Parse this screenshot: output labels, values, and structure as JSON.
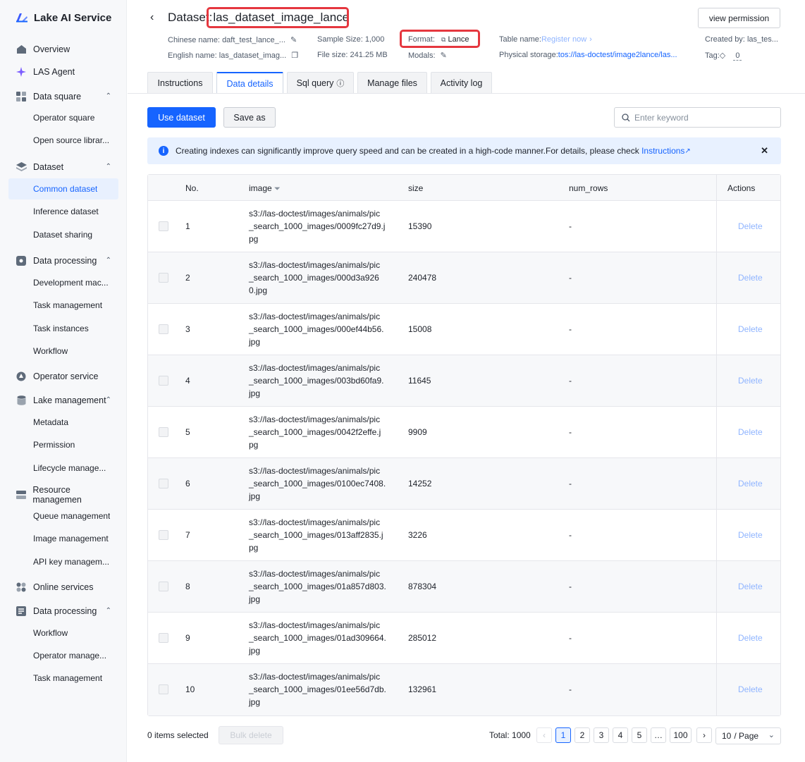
{
  "app": {
    "brand": "Lake AI Service"
  },
  "sidebar": {
    "items": [
      {
        "label": "Overview",
        "icon": "home-icon",
        "level": "top"
      },
      {
        "label": "LAS Agent",
        "icon": "sparkle-icon",
        "level": "top"
      },
      {
        "label": "Data square",
        "icon": "grid-icon",
        "level": "top",
        "expanded": true
      },
      {
        "label": "Operator square",
        "level": "sub"
      },
      {
        "label": "Open source librar...",
        "level": "sub"
      },
      {
        "label": "Dataset",
        "icon": "layers-icon",
        "level": "top",
        "expanded": true
      },
      {
        "label": "Common dataset",
        "level": "sub",
        "active": true
      },
      {
        "label": "Inference dataset",
        "level": "sub"
      },
      {
        "label": "Dataset sharing",
        "level": "sub"
      },
      {
        "label": "Data processing",
        "icon": "gear-icon",
        "level": "top",
        "expanded": true
      },
      {
        "label": "Development mac...",
        "level": "sub"
      },
      {
        "label": "Task management",
        "level": "sub"
      },
      {
        "label": "Task instances",
        "level": "sub"
      },
      {
        "label": "Workflow",
        "level": "sub"
      },
      {
        "label": "Operator service",
        "icon": "operator-icon",
        "level": "top"
      },
      {
        "label": "Lake management",
        "icon": "database-icon",
        "level": "top",
        "expanded": true
      },
      {
        "label": "Metadata",
        "level": "sub"
      },
      {
        "label": "Permission",
        "level": "sub"
      },
      {
        "label": "Lifecycle manage...",
        "level": "sub"
      },
      {
        "label": "Resource managemen",
        "icon": "server-icon",
        "level": "top"
      },
      {
        "label": "Queue management",
        "level": "sub"
      },
      {
        "label": "Image management",
        "level": "sub"
      },
      {
        "label": "API key managem...",
        "level": "sub"
      },
      {
        "label": "Online services",
        "icon": "cluster-icon",
        "level": "top"
      },
      {
        "label": "Data processing",
        "icon": "pipeline-icon",
        "level": "top",
        "expanded": true
      },
      {
        "label": "Workflow",
        "level": "sub"
      },
      {
        "label": "Operator manage...",
        "level": "sub"
      },
      {
        "label": "Task management",
        "level": "sub"
      }
    ]
  },
  "header": {
    "title_prefix": "Dataset:",
    "title_name": "las_dataset_image_lance",
    "view_permission": "view permission",
    "chinese_name_label": "Chinese name:",
    "chinese_name": "daft_test_lance_...",
    "english_name_label": "English name:",
    "english_name": "las_dataset_imag...",
    "sample_size_label": "Sample Size:",
    "sample_size": "1,000",
    "file_size_label": "File size:",
    "file_size": "241.25 MB",
    "format_label": "Format:",
    "format": "Lance",
    "modals_label": "Modals:",
    "table_name_label": "Table name:",
    "table_name_link": "Register now",
    "physical_storage_label": "Physical storage:",
    "physical_storage": "tos://las-doctest/image2lance/las...",
    "created_by_label": "Created by:",
    "created_by": "las_tes...",
    "tag_label": "Tag:",
    "tag_count": "0"
  },
  "tabs": [
    {
      "label": "Instructions"
    },
    {
      "label": "Data details",
      "active": true
    },
    {
      "label": "Sql query"
    },
    {
      "label": "Manage files"
    },
    {
      "label": "Activity log"
    }
  ],
  "toolbar": {
    "use_dataset": "Use dataset",
    "save_as": "Save as",
    "search_placeholder": "Enter keyword"
  },
  "alert": {
    "text": "Creating indexes can significantly improve query speed and can be created in a high-code manner.For details, please check ",
    "link": "Instructions"
  },
  "table": {
    "columns": [
      "No.",
      "image",
      "size",
      "num_rows",
      "Actions"
    ],
    "delete_label": "Delete",
    "rows": [
      {
        "no": "1",
        "image": "s3://las-doctest/images/animals/pic_search_1000_images/0009fc27d9.jpg",
        "lines": [
          "s3://las-doctest/images/animals/pic",
          "_search_1000_images/0009fc27d9.j",
          "pg"
        ],
        "size": "15390",
        "num_rows": "-"
      },
      {
        "no": "2",
        "image": "s3://las-doctest/images/animals/pic_search_1000_images/000d3a9260.jpg",
        "lines": [
          "s3://las-doctest/images/animals/pic",
          "_search_1000_images/000d3a926",
          "0.jpg"
        ],
        "size": "240478",
        "num_rows": "-"
      },
      {
        "no": "3",
        "image": "s3://las-doctest/images/animals/pic_search_1000_images/000ef44b56.jpg",
        "lines": [
          "s3://las-doctest/images/animals/pic",
          "_search_1000_images/000ef44b56.",
          "jpg"
        ],
        "size": "15008",
        "num_rows": "-"
      },
      {
        "no": "4",
        "image": "s3://las-doctest/images/animals/pic_search_1000_images/003bd60fa9.jpg",
        "lines": [
          "s3://las-doctest/images/animals/pic",
          "_search_1000_images/003bd60fa9.",
          "jpg"
        ],
        "size": "11645",
        "num_rows": "-"
      },
      {
        "no": "5",
        "image": "s3://las-doctest/images/animals/pic_search_1000_images/0042f2effe.jpg",
        "lines": [
          "s3://las-doctest/images/animals/pic",
          "_search_1000_images/0042f2effe.j",
          "pg"
        ],
        "size": "9909",
        "num_rows": "-"
      },
      {
        "no": "6",
        "image": "s3://las-doctest/images/animals/pic_search_1000_images/0100ec7408.jpg",
        "lines": [
          "s3://las-doctest/images/animals/pic",
          "_search_1000_images/0100ec7408.",
          "jpg"
        ],
        "size": "14252",
        "num_rows": "-"
      },
      {
        "no": "7",
        "image": "s3://las-doctest/images/animals/pic_search_1000_images/013aff2835.jpg",
        "lines": [
          "s3://las-doctest/images/animals/pic",
          "_search_1000_images/013aff2835.j",
          "pg"
        ],
        "size": "3226",
        "num_rows": "-"
      },
      {
        "no": "8",
        "image": "s3://las-doctest/images/animals/pic_search_1000_images/01a857d803.jpg",
        "lines": [
          "s3://las-doctest/images/animals/pic",
          "_search_1000_images/01a857d803.",
          "jpg"
        ],
        "size": "878304",
        "num_rows": "-"
      },
      {
        "no": "9",
        "image": "s3://las-doctest/images/animals/pic_search_1000_images/01ad309664.jpg",
        "lines": [
          "s3://las-doctest/images/animals/pic",
          "_search_1000_images/01ad309664.",
          "jpg"
        ],
        "size": "285012",
        "num_rows": "-"
      },
      {
        "no": "10",
        "image": "s3://las-doctest/images/animals/pic_search_1000_images/01ee56d7db.jpg",
        "lines": [
          "s3://las-doctest/images/animals/pic",
          "_search_1000_images/01ee56d7db.",
          "jpg"
        ],
        "size": "132961",
        "num_rows": "-"
      }
    ]
  },
  "footer": {
    "selected": "0 items selected",
    "bulk_delete": "Bulk delete",
    "total": "Total: 1000",
    "pages": [
      "1",
      "2",
      "3",
      "4",
      "5",
      "…",
      "100"
    ],
    "current_page": "1",
    "page_size": "10",
    "page_size_suffix": "/ Page"
  },
  "colors": {
    "accent": "#1664ff",
    "highlight": "#e5373f"
  }
}
